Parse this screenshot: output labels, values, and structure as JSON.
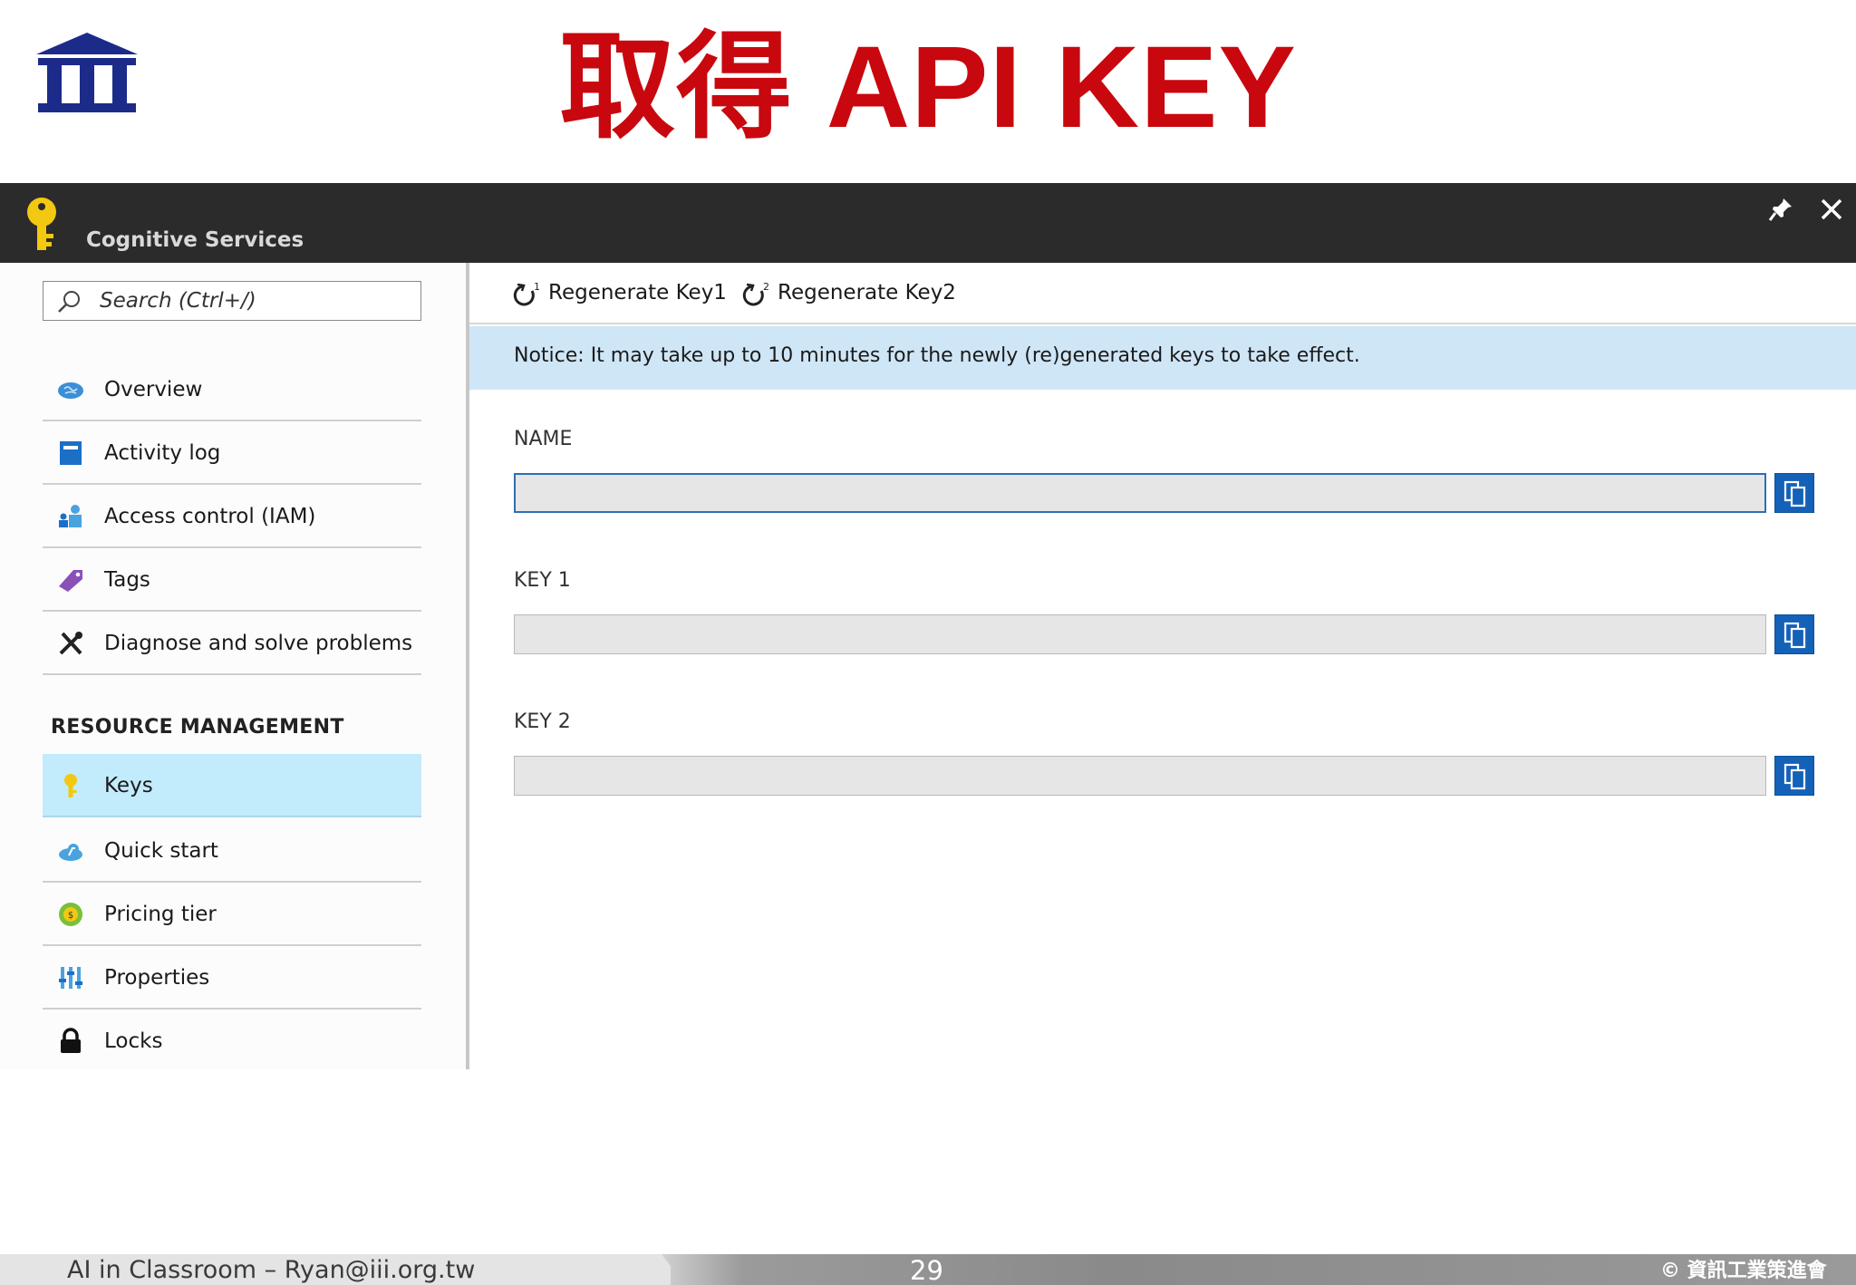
{
  "slide": {
    "title": "取得 API KEY"
  },
  "blade": {
    "title": "Cognitive Services"
  },
  "search": {
    "placeholder": "Search (Ctrl+/)"
  },
  "menu": {
    "items": [
      {
        "label": "Overview",
        "icon": "brain-cloud-icon"
      },
      {
        "label": "Activity log",
        "icon": "activity-log-icon"
      },
      {
        "label": "Access control (IAM)",
        "icon": "users-icon"
      },
      {
        "label": "Tags",
        "icon": "tag-icon"
      },
      {
        "label": "Diagnose and solve problems",
        "icon": "wrench-icon"
      }
    ],
    "section_label": "RESOURCE MANAGEMENT",
    "resource_items": [
      {
        "label": "Keys",
        "icon": "key-icon",
        "selected": true
      },
      {
        "label": "Quick start",
        "icon": "cloud-icon"
      },
      {
        "label": "Pricing tier",
        "icon": "pricing-icon"
      },
      {
        "label": "Properties",
        "icon": "properties-icon"
      },
      {
        "label": "Locks",
        "icon": "lock-icon"
      }
    ]
  },
  "toolbar": {
    "regen1_label": "Regenerate Key1",
    "regen2_label": "Regenerate Key2"
  },
  "notice": {
    "text": "Notice: It may take up to 10 minutes for the newly (re)generated keys to take effect."
  },
  "fields": {
    "name_label": "NAME",
    "name_value": "",
    "key1_label": "KEY 1",
    "key1_value": "",
    "key2_label": "KEY 2",
    "key2_value": ""
  },
  "footer": {
    "left": "AI in Classroom – Ryan@iii.org.tw",
    "page": "29",
    "right": "© 資訊工業策進會"
  },
  "colors": {
    "title_red": "#c8080e",
    "blade_header": "#2b2b2b",
    "selected_bg": "#c2ebfb",
    "notice_bg": "#cfe6f7",
    "copy_blue": "#1461b8"
  }
}
